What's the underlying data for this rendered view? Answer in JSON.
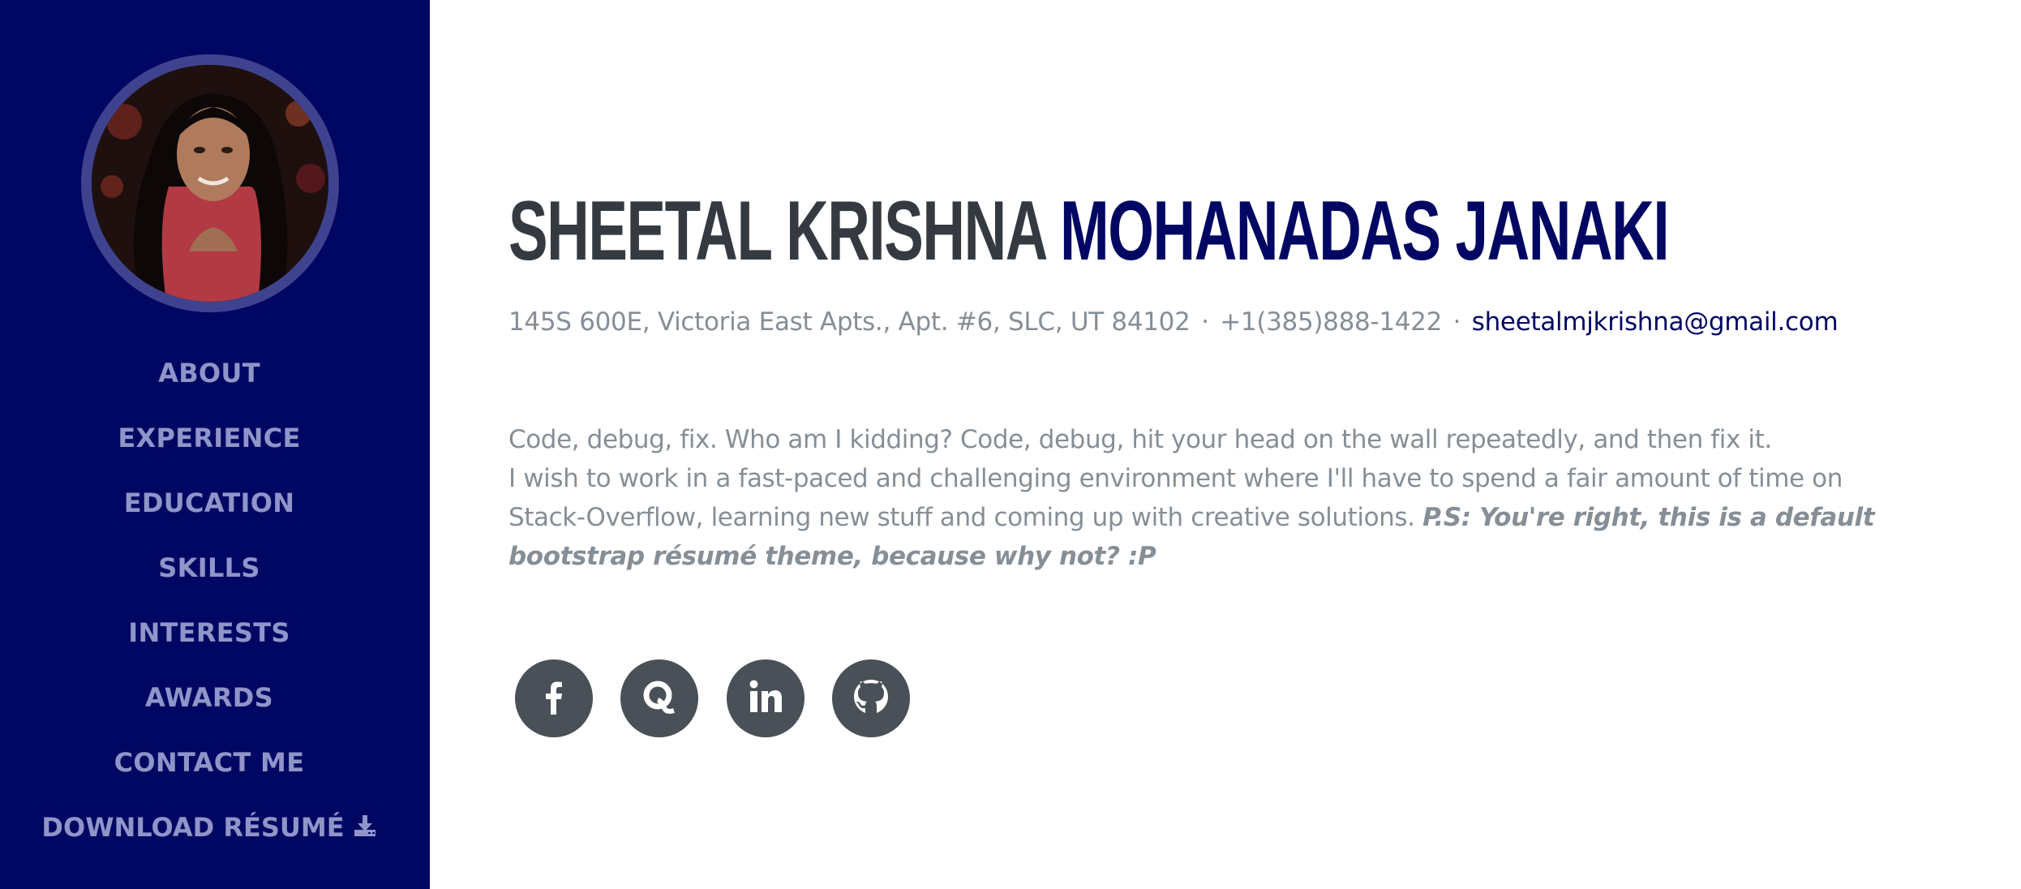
{
  "profile": {
    "first_name": "SHEETAL KRISHNA",
    "last_name": "MOHANADAS JANAKI",
    "address": "145S 600E, Victoria East Apts., Apt. #6, SLC, UT 84102",
    "separator": "·",
    "phone": "+1(385)888-1422",
    "email": "sheetalmjkrishna@gmail.com",
    "avatar_alt": "Profile photo"
  },
  "nav": {
    "items": [
      {
        "label": "ABOUT"
      },
      {
        "label": "EXPERIENCE"
      },
      {
        "label": "EDUCATION"
      },
      {
        "label": "SKILLS"
      },
      {
        "label": "INTERESTS"
      },
      {
        "label": "AWARDS"
      },
      {
        "label": "CONTACT ME"
      },
      {
        "label": "DOWNLOAD RÉSUMÉ",
        "icon": "download-icon"
      }
    ]
  },
  "about": {
    "line1": "Code, debug, fix. Who am I kidding? Code, debug, hit your head on the wall repeatedly, and then fix it.",
    "line2": "I wish to work in a fast-paced and challenging environment where I'll have to spend a fair amount of time on Stack-Overflow, learning new stuff and coming up with creative solutions.",
    "ps": "P.S: You're right, this is a default bootstrap résumé theme, because why not? :P"
  },
  "social": [
    {
      "name": "facebook",
      "icon": "facebook-icon"
    },
    {
      "name": "quora",
      "icon": "quora-icon"
    },
    {
      "name": "linkedin",
      "icon": "linkedin-icon"
    },
    {
      "name": "github",
      "icon": "github-icon"
    }
  ],
  "colors": {
    "sidebar_bg": "#000763",
    "accent": "#000763",
    "nav_text": "#8f95c8",
    "heading": "#343a40",
    "muted_text": "#868e96",
    "social_bg": "#495057"
  }
}
